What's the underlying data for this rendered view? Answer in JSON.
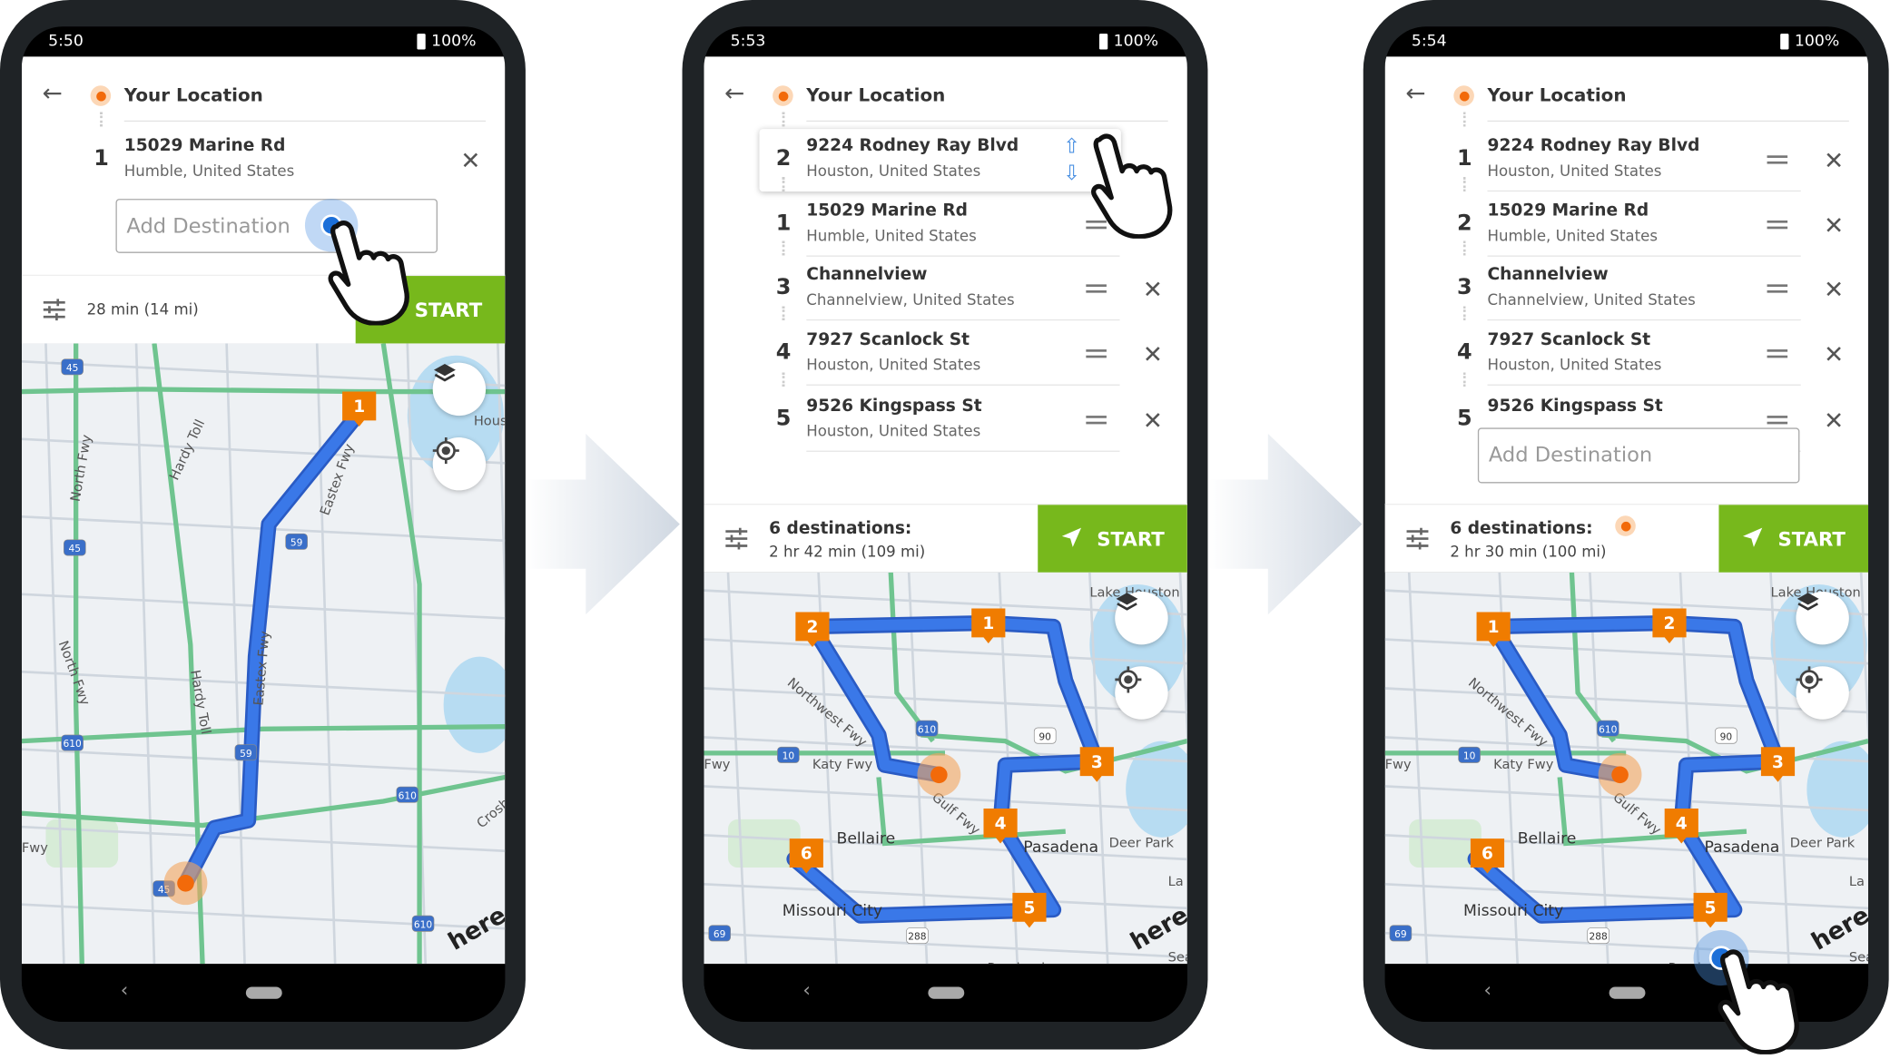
{
  "phones": [
    {
      "status": {
        "time": "5:50",
        "battery": "100%"
      },
      "origin": "Your Location",
      "stops": [
        {
          "num": "1",
          "title": "15029 Marine Rd",
          "subtitle": "Humble, United States"
        }
      ],
      "add_destination_placeholder": "Add Destination",
      "summary": {
        "title": "",
        "detail": "28 min (14 mi)"
      },
      "start_label": "START",
      "map": {
        "markers": [
          "1"
        ],
        "labels": [
          "Hardy Toll",
          "North Fwy",
          "North Fwy",
          "Hardy Toll",
          "Eastex Fwy",
          "Eastex Fwy",
          "Fwy",
          "Crosby",
          "Houston"
        ],
        "shields": [
          "45",
          "45",
          "59",
          "59",
          "610",
          "610",
          "610",
          "45"
        ],
        "logo": "here"
      }
    },
    {
      "status": {
        "time": "5:53",
        "battery": "100%"
      },
      "origin": "Your Location",
      "stops": [
        {
          "num": "2",
          "title": "9224 Rodney Ray Blvd",
          "subtitle": "Houston, United States",
          "dragging": true
        },
        {
          "num": "1",
          "title": "15029 Marine Rd",
          "subtitle": "Humble, United States"
        },
        {
          "num": "3",
          "title": "Channelview",
          "subtitle": "Channelview, United States"
        },
        {
          "num": "4",
          "title": "7927 Scanlock St",
          "subtitle": "Houston, United States"
        },
        {
          "num": "5",
          "title": "9526 Kingspass St",
          "subtitle": "Houston, United States"
        }
      ],
      "summary": {
        "title": "6 destinations:",
        "detail": "2 hr 42 min (109 mi)"
      },
      "start_label": "START",
      "map": {
        "markers": [
          "1",
          "2",
          "3",
          "4",
          "5",
          "6"
        ],
        "labels": [
          "Lake Houston",
          "Northwest Fwy",
          "Katy Fwy",
          "Fwy",
          "Gulf Fwy",
          "Bellaire",
          "Pasadena",
          "Deer Park",
          "Missouri City",
          "Pearland",
          "La",
          "Sea"
        ],
        "shields": [
          "610",
          "10",
          "90",
          "288",
          "69"
        ],
        "logo": "here"
      }
    },
    {
      "status": {
        "time": "5:54",
        "battery": "100%"
      },
      "origin": "Your Location",
      "stops": [
        {
          "num": "1",
          "title": "9224 Rodney Ray Blvd",
          "subtitle": "Houston, United States"
        },
        {
          "num": "2",
          "title": "15029 Marine Rd",
          "subtitle": "Humble, United States"
        },
        {
          "num": "3",
          "title": "Channelview",
          "subtitle": "Channelview, United States"
        },
        {
          "num": "4",
          "title": "7927 Scanlock St",
          "subtitle": "Houston, United States"
        },
        {
          "num": "5",
          "title": "9526 Kingspass St",
          "subtitle": ""
        }
      ],
      "add_destination_placeholder": "Add Destination",
      "summary": {
        "title": "6 destinations:",
        "detail": "2 hr 30 min (100 mi)"
      },
      "start_label": "START",
      "map": {
        "markers": [
          "1",
          "2",
          "3",
          "4",
          "5",
          "6"
        ],
        "labels": [
          "Lake Houston",
          "Northwest Fwy",
          "Katy Fwy",
          "Fwy",
          "Gulf Fwy",
          "Bellaire",
          "Pasadena",
          "Deer Park",
          "Missouri City",
          "Pearl",
          "La",
          "Sea"
        ],
        "shields": [
          "610",
          "10",
          "90",
          "288",
          "69"
        ],
        "logo": "here"
      }
    }
  ],
  "colors": {
    "start_green": "#77b81c",
    "route_blue": "#3a78e8",
    "marker_orange": "#f07c00",
    "location_orange": "#f26a0a"
  }
}
